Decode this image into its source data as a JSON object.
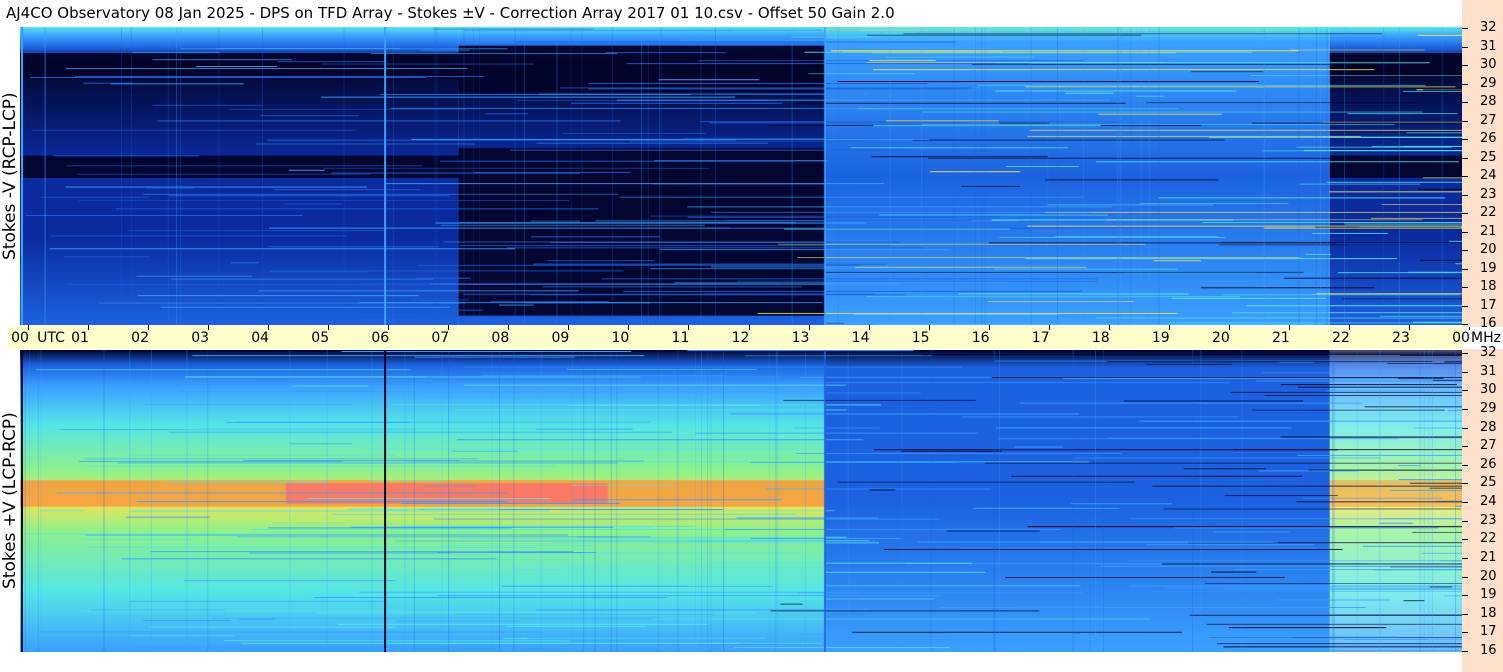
{
  "title": "AJ4CO Observatory  08 Jan 2025  -  DPS on TFD Array  -  Stokes ±V  -  Correction Array 2017 01 10.csv  -  Offset 50  Gain 2.0",
  "chart_data": {
    "type": "heatmap",
    "x_unit_label": "UTC",
    "y_unit_label": "MHz",
    "x_ticks": [
      "00",
      "01",
      "02",
      "03",
      "04",
      "05",
      "06",
      "07",
      "08",
      "09",
      "10",
      "11",
      "12",
      "13",
      "14",
      "15",
      "16",
      "17",
      "18",
      "19",
      "20",
      "21",
      "22",
      "23",
      "00"
    ],
    "y_ticks": [
      "32",
      "31",
      "30",
      "29",
      "28",
      "27",
      "26",
      "25",
      "24",
      "23",
      "22",
      "21",
      "20",
      "19",
      "18",
      "17",
      "16"
    ],
    "xlim_hours": [
      0,
      24
    ],
    "ylim_mhz": [
      16,
      32
    ],
    "panels": [
      {
        "name": "Stokes -V (RCP-LCP)",
        "segments": [
          {
            "start_h": 0.0,
            "end_h": 7.3,
            "tone": "dark",
            "bands_mhz": [
              [
                29.2,
                30.6
              ],
              [
                23.9,
                25.1
              ]
            ]
          },
          {
            "start_h": 7.3,
            "end_h": 13.4,
            "tone": "dark",
            "bands_mhz": [
              [
                28.5,
                31.0
              ],
              [
                16.5,
                25.5
              ]
            ]
          },
          {
            "start_h": 13.4,
            "end_h": 21.8,
            "tone": "bright",
            "bands_mhz": []
          },
          {
            "start_h": 21.8,
            "end_h": 24.0,
            "tone": "dark",
            "bands_mhz": [
              [
                29.3,
                30.6
              ],
              [
                23.9,
                25.1
              ]
            ]
          }
        ]
      },
      {
        "name": "Stokes +V (LCP-RCP)",
        "segments": [
          {
            "start_h": 0.0,
            "end_h": 13.4,
            "tone": "warm",
            "bands_mhz": [
              [
                23.7,
                25.1
              ]
            ]
          },
          {
            "start_h": 13.4,
            "end_h": 21.8,
            "tone": "cool",
            "bands_mhz": []
          },
          {
            "start_h": 21.8,
            "end_h": 24.0,
            "tone": "warm-faint",
            "bands_mhz": [
              [
                23.7,
                25.1
              ]
            ]
          }
        ]
      }
    ],
    "colors": {
      "dark": "#02042a",
      "deep_blue": "#0a2a9e",
      "mid_blue": "#1c62e0",
      "light_blue": "#3aa0ff",
      "cyan": "#55e6e6",
      "green": "#8ef08a",
      "yellow": "#f4e04e",
      "orange": "#f79a3e",
      "pink": "#ff5d7a"
    }
  }
}
